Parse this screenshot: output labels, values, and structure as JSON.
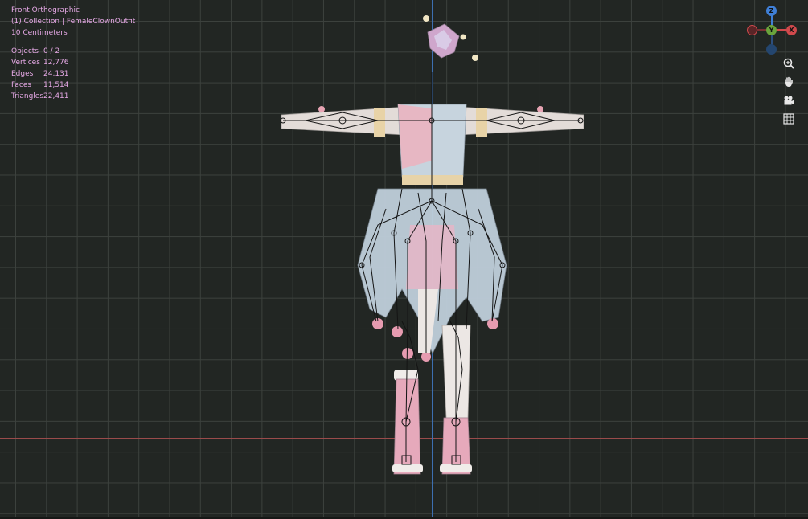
{
  "viewport": {
    "view_name": "Front Orthographic",
    "collection_label": "(1) Collection | FemaleClownOutfit",
    "grid_scale": "10 Centimeters"
  },
  "statistics": [
    {
      "label": "Objects",
      "value": "0 / 2"
    },
    {
      "label": "Vertices",
      "value": "12,776"
    },
    {
      "label": "Edges",
      "value": "24,131"
    },
    {
      "label": "Faces",
      "value": "11,514"
    },
    {
      "label": "Triangles",
      "value": "22,411"
    }
  ],
  "gizmo": {
    "z_label": "Z",
    "y_label": "Y",
    "x_label": "X",
    "x_color": "#d0494c",
    "y_color": "#6aa33c",
    "z_color": "#3f7fd6"
  },
  "nav_tools": [
    {
      "name": "zoom-icon"
    },
    {
      "name": "pan-hand-icon"
    },
    {
      "name": "camera-icon"
    },
    {
      "name": "grid-view-icon"
    }
  ],
  "colors": {
    "background": "#222623",
    "grid": "#3c413d",
    "x_axis": "#9a4b4b",
    "z_axis": "#3d6fb0",
    "overlay_text": "#e6a9e6"
  }
}
